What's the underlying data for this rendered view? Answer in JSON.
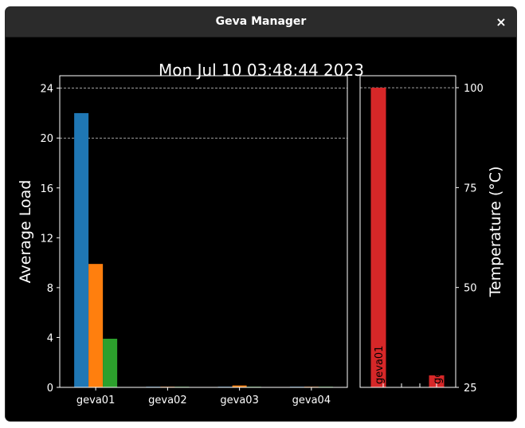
{
  "window": {
    "title": "Geva Manager",
    "close_glyph": "×",
    "close_icon": "close-icon"
  },
  "figure": {
    "title": "Mon Jul 10 03:48:44 2023"
  },
  "chart_data": [
    {
      "type": "bar",
      "title": "",
      "ylabel": "Average Load",
      "xlabel": "",
      "categories": [
        "geva01",
        "geva02",
        "geva03",
        "geva04"
      ],
      "ylim": [
        0,
        25
      ],
      "yticks": [
        0,
        4,
        8,
        12,
        16,
        20,
        24
      ],
      "reference_lines": [
        20,
        24
      ],
      "grid": false,
      "series": [
        {
          "color": "#1f77b4",
          "values": [
            22,
            0.05,
            0.05,
            0.05
          ]
        },
        {
          "color": "#ff7f0e",
          "values": [
            9.9,
            0.05,
            0.15,
            0.05
          ]
        },
        {
          "color": "#2ca02c",
          "values": [
            3.9,
            0.05,
            0.05,
            0.05
          ]
        }
      ]
    },
    {
      "type": "bar",
      "title": "",
      "ylabel": "Temperature (°C)",
      "xlabel": "",
      "ylim": [
        25,
        103
      ],
      "yticks": [
        25,
        50,
        75,
        100
      ],
      "reference_lines": [
        100
      ],
      "grid": false,
      "bars": [
        {
          "label": "geva01",
          "value": 100,
          "color": "#d62728"
        },
        {
          "label": "geva0",
          "value": 28,
          "color": "#d62728"
        }
      ]
    }
  ]
}
